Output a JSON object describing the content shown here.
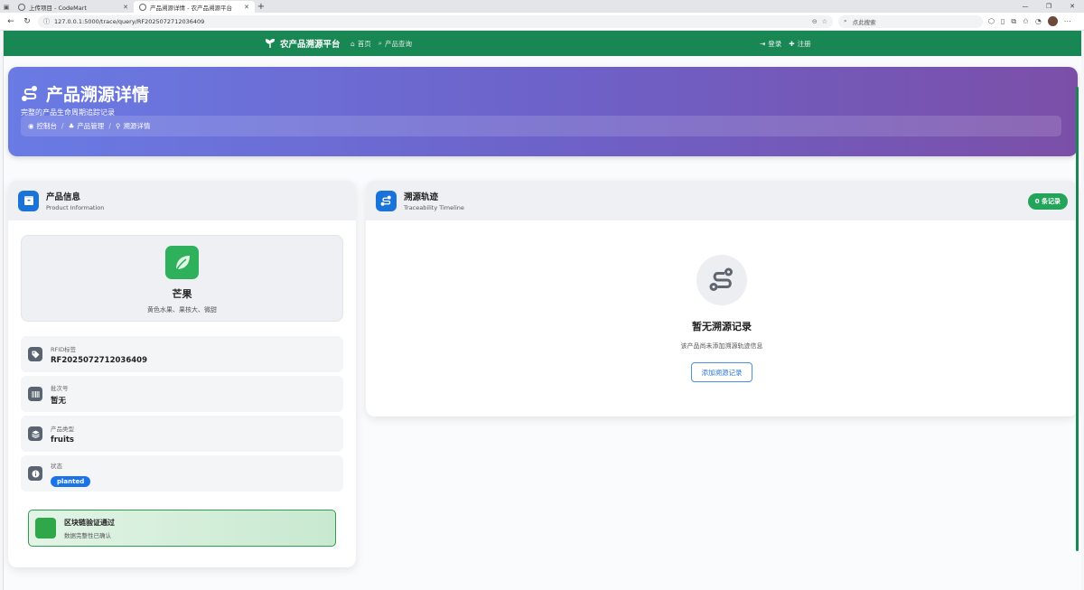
{
  "browser": {
    "tabs": [
      {
        "title": "上传项目 - CodeMart",
        "active": false
      },
      {
        "title": "产品溯源详情 - 农产品溯源平台",
        "active": true
      }
    ],
    "url": "127.0.0.1:5000/trace/query/RF2025072712036409",
    "search_placeholder": "点此搜索"
  },
  "navbar": {
    "brand": "农产品溯源平台",
    "links": [
      "首页",
      "产品查询"
    ],
    "auth": [
      "登录",
      "注册"
    ],
    "color": "#198754"
  },
  "hero": {
    "title": "产品溯源详情",
    "subtitle": "完整的产品生命周期追踪记录",
    "breadcrumbs": [
      "控制台",
      "产品管理",
      "溯源详情"
    ]
  },
  "product_card": {
    "title": "产品信息",
    "subtitle": "Product Information",
    "product_name": "芒果",
    "product_desc": "黄色水果、果核大、微甜",
    "fields": [
      {
        "label": "RFID标签",
        "value": "RF2025072712036409",
        "icon": "tag-icon"
      },
      {
        "label": "批次号",
        "value": "暂无",
        "icon": "barcode-icon"
      },
      {
        "label": "产品类型",
        "value": "fruits",
        "icon": "layers-icon"
      },
      {
        "label": "状态",
        "value": "planted",
        "icon": "info-icon"
      }
    ],
    "verify_title": "区块链验证通过",
    "verify_sub": "数据完整性已确认"
  },
  "trace_card": {
    "title": "溯源轨迹",
    "subtitle": "Traceability Timeline",
    "count_badge": "0 条记录",
    "empty_title": "暂无溯源记录",
    "empty_sub": "该产品尚未添加溯源轨迹信息",
    "add_button": "添加溯源记录"
  }
}
